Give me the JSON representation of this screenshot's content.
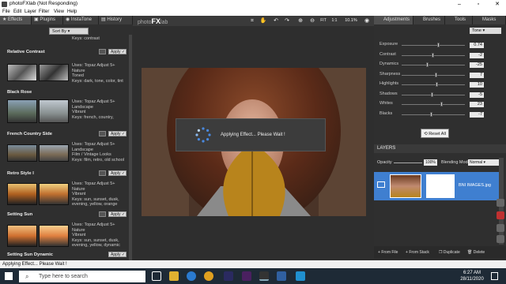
{
  "window": {
    "title": "photoFXlab (Not Responding)"
  },
  "menu": [
    "File",
    "Edit",
    "Layer",
    "Filter",
    "View",
    "Help"
  ],
  "left_tabs": [
    "Effects",
    "Plugins",
    "InstaTone",
    "History"
  ],
  "sort_by": "Sort By",
  "effects_top_keys": "Keys: contrast",
  "effects": [
    {
      "name": "Relative Contrast",
      "desc": "Uses: Topaz Adjust 5+\nNature\nToned\nKeys: dark, tone, color, tint",
      "apply": "Apply"
    },
    {
      "name": "Black Rose",
      "desc": "Uses: Topaz Adjust 5+\nLandscape\nVibrant\nKeys: french, country,",
      "apply": "Apply"
    },
    {
      "name": "French Country Side",
      "desc": "Uses: Topaz Adjust 5+\nLandscape\nFilm / Vintage Looks\nKeys: film, retro, old school",
      "apply": "Apply"
    },
    {
      "name": "Retro Style I",
      "desc": "Uses: Topaz Adjust 5+\nNature\nVibrant\nKeys: sun, sunset, dusk,\nevening, yellow, orange",
      "apply": "Apply"
    },
    {
      "name": "Setting Sun",
      "desc": "Uses: Topaz Adjust 5+\nNature\nVibrant\nKeys: sun, sunset, dusk,\nevening, yellow, dynamic",
      "apply": "Apply"
    },
    {
      "name": "Setting Sun Dynamic",
      "desc": "",
      "apply": "Apply"
    }
  ],
  "logo": {
    "a": "photo",
    "b": "FX",
    "c": "lab"
  },
  "zoom": {
    "fit": "FIT",
    "one": "1:1",
    "pct": "10.1%"
  },
  "dialog": {
    "message": "Applying Effect... Please Wait !"
  },
  "right_tabs": [
    "Adjustments",
    "Brushes",
    "Tools",
    "Masks"
  ],
  "tone_select": "Tone",
  "sliders": [
    {
      "label": "Exposure",
      "value": "0.74",
      "pos": 0.58
    },
    {
      "label": "Contrast",
      "value": "-2",
      "pos": 0.49
    },
    {
      "label": "Dynamics",
      "value": "-25",
      "pos": 0.4
    },
    {
      "label": "Sharpness",
      "value": "7",
      "pos": 0.54
    },
    {
      "label": "Highlights",
      "value": "10",
      "pos": 0.55
    },
    {
      "label": "Shadows",
      "value": "-5",
      "pos": 0.47
    },
    {
      "label": "Whites",
      "value": "23",
      "pos": 0.62
    },
    {
      "label": "Blacks",
      "value": "-7",
      "pos": 0.46
    }
  ],
  "reset_all": "Reset All",
  "layers": {
    "header": "LAYERS",
    "opacity_label": "Opacity",
    "opacity_value": "100%",
    "blend_label": "Blending Mode",
    "blend_value": "Normal",
    "layer_name": "BNI IMAGES.jpg",
    "footer": [
      "From File",
      "From Stack",
      "Duplicate",
      "Delete"
    ]
  },
  "status": "Applying Effect... Please Wait !",
  "taskbar": {
    "search": "Type here to search",
    "time": "6:27 AM",
    "date": "28/11/2020"
  }
}
